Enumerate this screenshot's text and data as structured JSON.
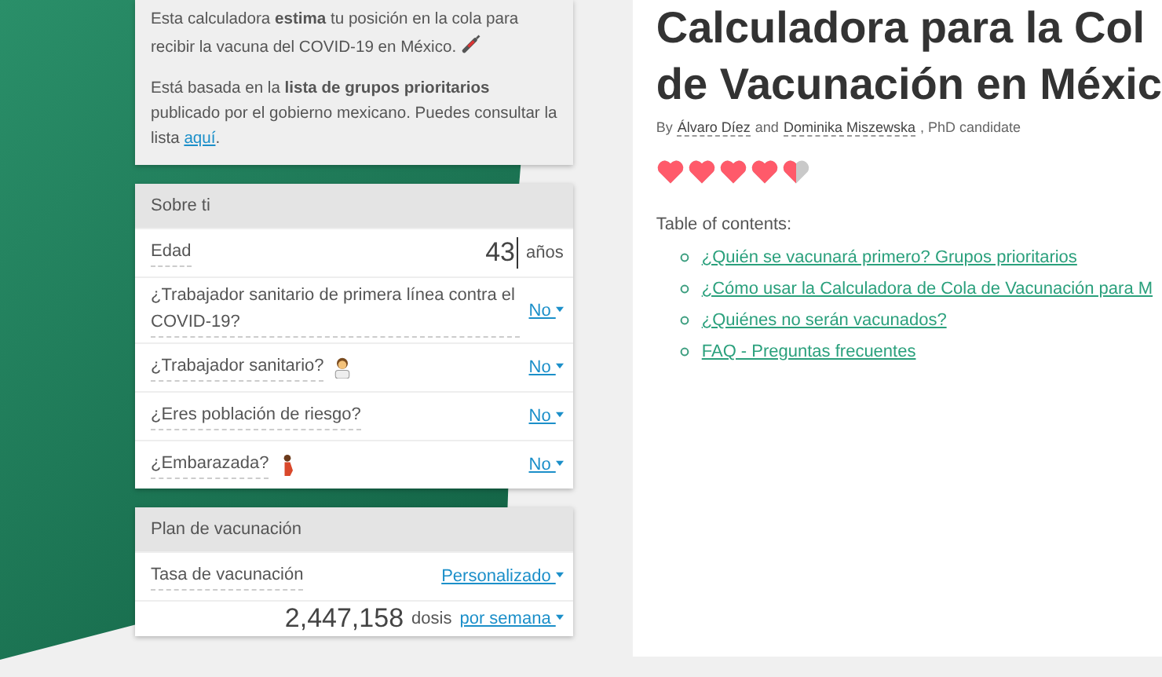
{
  "intro": {
    "paragraphs": [
      "Esta calculadora **estima** tu posición en la cola para recibir la vacuna del COVID-19 en México.",
      "Está basada en la **lista de grupos prioritarios** publicado por el gobierno mexicano. Puedes consultar la lista"
    ],
    "link": "aquí",
    "trailing": "."
  },
  "about": {
    "title": "Sobre ti",
    "age": {
      "label": "Edad",
      "value": "43",
      "unit": "años"
    },
    "questions": [
      {
        "label": "¿Trabajador sanitario de primera línea contra el COVID-19?",
        "value": "No"
      },
      {
        "label": "¿Trabajador sanitario?",
        "value": "No"
      },
      {
        "label": "¿Eres población de riesgo?",
        "value": "No"
      },
      {
        "label": "¿Embarazada?",
        "value": "No"
      }
    ]
  },
  "plan": {
    "title": "Plan de vacunación",
    "rate": {
      "label": "Tasa de vacunación",
      "value": "Personalizado"
    },
    "doses": {
      "value": "2,447,158",
      "unit": "dosis",
      "period": "por semana"
    }
  },
  "article": {
    "title_lines": [
      "Calculadora para la Col",
      "de Vacunación en Méxic"
    ],
    "byline": {
      "prefix": "By",
      "authors": [
        "Álvaro Díez",
        "Dominika Miszewska"
      ],
      "joiner": "and",
      "suffix": ", PhD candidate"
    },
    "stars": 4.5,
    "toc": {
      "title": "Table of contents:",
      "items": [
        "¿Quién se vacunará primero? Grupos prioritarios",
        "¿Cómo usar la Calculadora de Cola de Vacunación para M",
        "¿Quiénes no serán vacunados?",
        "FAQ - Preguntas frecuentes"
      ]
    }
  }
}
